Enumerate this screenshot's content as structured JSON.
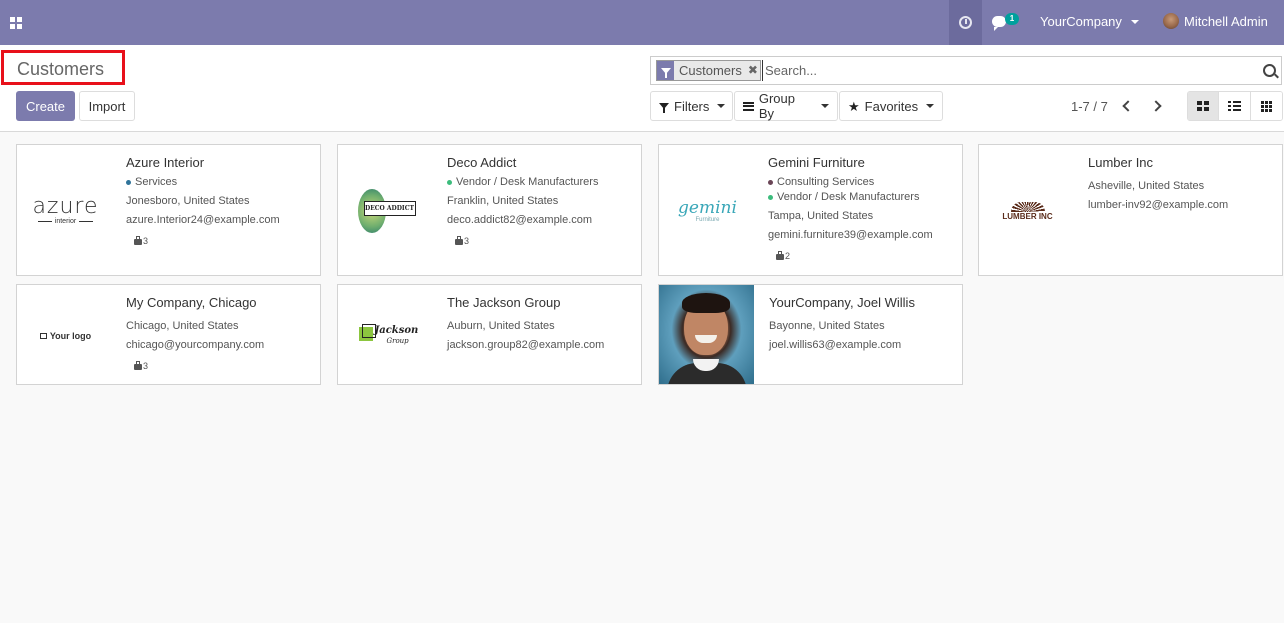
{
  "navbar": {
    "company": "YourCompany",
    "user": "Mitchell Admin",
    "chat_count": "1"
  },
  "control_panel": {
    "title": "Customers",
    "create_label": "Create",
    "import_label": "Import",
    "search": {
      "facet_label": "Customers",
      "facet_remove": "✖",
      "placeholder": "Search..."
    },
    "filters_label": "Filters",
    "groupby_label": "Group By",
    "favorites_label": "Favorites",
    "pager": "1-7 / 7"
  },
  "colors": {
    "brand": "#7c7bad",
    "tag_services": "#30749a",
    "tag_vendor": "#3cbc7c",
    "tag_consulting": "#6a4556"
  },
  "cards": [
    {
      "name": "Azure Interior",
      "tags": [
        {
          "label": "Services"
        }
      ],
      "address": "Jonesboro, United States",
      "email": "azure.Interior24@example.com",
      "meetings": "3",
      "logo": {
        "big": "azure",
        "small": "interior"
      }
    },
    {
      "name": "Deco Addict",
      "tags": [
        {
          "label": "Vendor / Desk Manufacturers"
        }
      ],
      "address": "Franklin, United States",
      "email": "deco.addict82@example.com",
      "meetings": "3",
      "logo": {
        "big": "DECO ADDICT"
      }
    },
    {
      "name": "Gemini Furniture",
      "tags": [
        {
          "label": "Consulting Services"
        },
        {
          "label": "Vendor / Desk Manufacturers"
        }
      ],
      "address": "Tampa, United States",
      "email": "gemini.furniture39@example.com",
      "meetings": "2",
      "logo": {
        "big": "gemini",
        "small": "Furniture"
      }
    },
    {
      "name": "Lumber Inc",
      "address": "Asheville, United States",
      "email": "lumber-inv92@example.com",
      "logo": {
        "big": "LUMBER INC"
      }
    },
    {
      "name": "My Company, Chicago",
      "address": "Chicago, United States",
      "email": "chicago@yourcompany.com",
      "meetings": "3",
      "logo": {
        "big": "Your logo"
      }
    },
    {
      "name": "The Jackson Group",
      "address": "Auburn, United States",
      "email": "jackson.group82@example.com",
      "logo": {
        "big": "Jackson",
        "small": "Group"
      }
    },
    {
      "name": "YourCompany, Joel Willis",
      "address": "Bayonne, United States",
      "email": "joel.willis63@example.com"
    }
  ]
}
